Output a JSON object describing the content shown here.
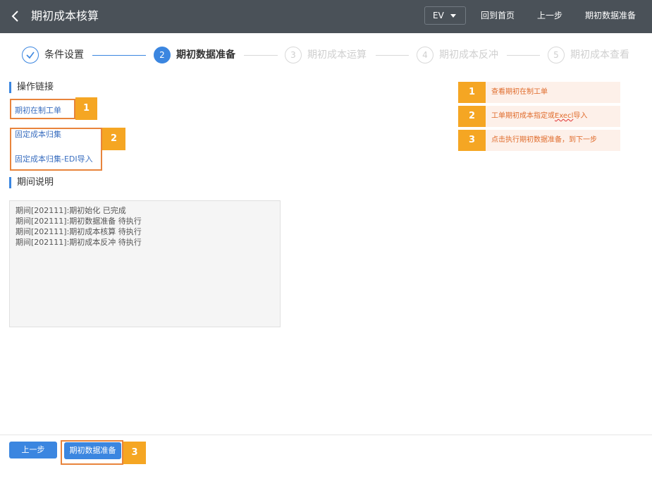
{
  "header": {
    "title": "期初成本核算",
    "ev_select": {
      "value": "EV"
    },
    "links": [
      "回到首页",
      "上一步",
      "期初数据准备"
    ]
  },
  "steps": [
    {
      "number": "",
      "label": "条件设置",
      "state": "done"
    },
    {
      "number": "2",
      "label": "期初数据准备",
      "state": "active"
    },
    {
      "number": "3",
      "label": "期初成本运算",
      "state": "todo"
    },
    {
      "number": "4",
      "label": "期初成本反冲",
      "state": "todo"
    },
    {
      "number": "5",
      "label": "期初成本查看",
      "state": "todo"
    }
  ],
  "operations": {
    "title": "操作链接",
    "links": [
      "期初在制工单",
      "固定成本归集",
      "固定成本归集-EDI导入"
    ],
    "badges": [
      "1",
      "2"
    ]
  },
  "period": {
    "title": "期间说明",
    "lines": [
      "期间[202111]:期初始化 已完成",
      "期间[202111]:期初数据准备 待执行",
      "期间[202111]:期初成本核算 待执行",
      "期间[202111]:期初成本反冲 待执行"
    ]
  },
  "tips": [
    {
      "num": "1",
      "text": "查看期初在制工单"
    },
    {
      "num": "2",
      "text_before": "工单期初成本指定或",
      "text_marked": "Execl",
      "text_after": "导入"
    },
    {
      "num": "3",
      "text": "点击执行期初数据准备，到下一步"
    }
  ],
  "footer": {
    "prev_label": "上一步",
    "prepare_label": "期初数据准备",
    "badge": "3"
  },
  "colors": {
    "accent": "#3b86e0",
    "header_bg": "#4a5158",
    "highlight": "#e8843c",
    "badge": "#f5a623"
  }
}
